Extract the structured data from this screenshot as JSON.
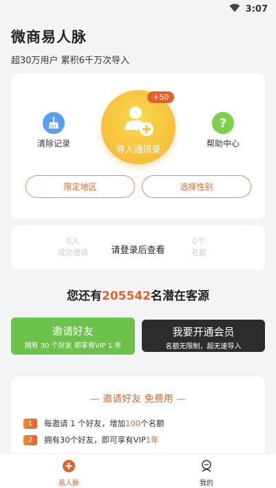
{
  "status": {
    "time": "3:07"
  },
  "header": {
    "title": "微商易人脉",
    "subtitle": "超30万用户 累积6千万次导入"
  },
  "main_card": {
    "clear_label": "清除记录",
    "import_label": "导入通讯录",
    "import_badge": "+50",
    "help_label": "帮助中心",
    "region_button": "限定地区",
    "gender_button": "选择性别"
  },
  "login_card": {
    "message": "请登录后查看",
    "ghost_left_num": "0人",
    "ghost_left_label": "成功邀请",
    "ghost_right_num": "0个",
    "ghost_right_label": "名额"
  },
  "potential": {
    "prefix": "您还有",
    "count": "205542",
    "suffix": "名潜在客源"
  },
  "invite_button": {
    "label": "邀请好友",
    "sub": "拥有 30 个好友 即享有VIP 1 年"
  },
  "vip_button": {
    "label": "我要开通会员",
    "sub": "名额无限制，超无速导入"
  },
  "invite_card": {
    "title": "—  邀请好友 免费用  —",
    "rules": [
      {
        "num": "1",
        "pre": "每邀请 1 个好友，增加",
        "hl": "100",
        "post": "个名额"
      },
      {
        "num": "2",
        "pre": "拥有30个好友，即可享有VIP",
        "hl": "1年",
        "post": ""
      }
    ]
  },
  "tabbar": {
    "home": "易人脉",
    "mine": "我的"
  },
  "colors": {
    "accent": "#e6602b",
    "green": "#6cc24a",
    "gold": "#f6bf3a",
    "dark": "#2c2c2c"
  }
}
